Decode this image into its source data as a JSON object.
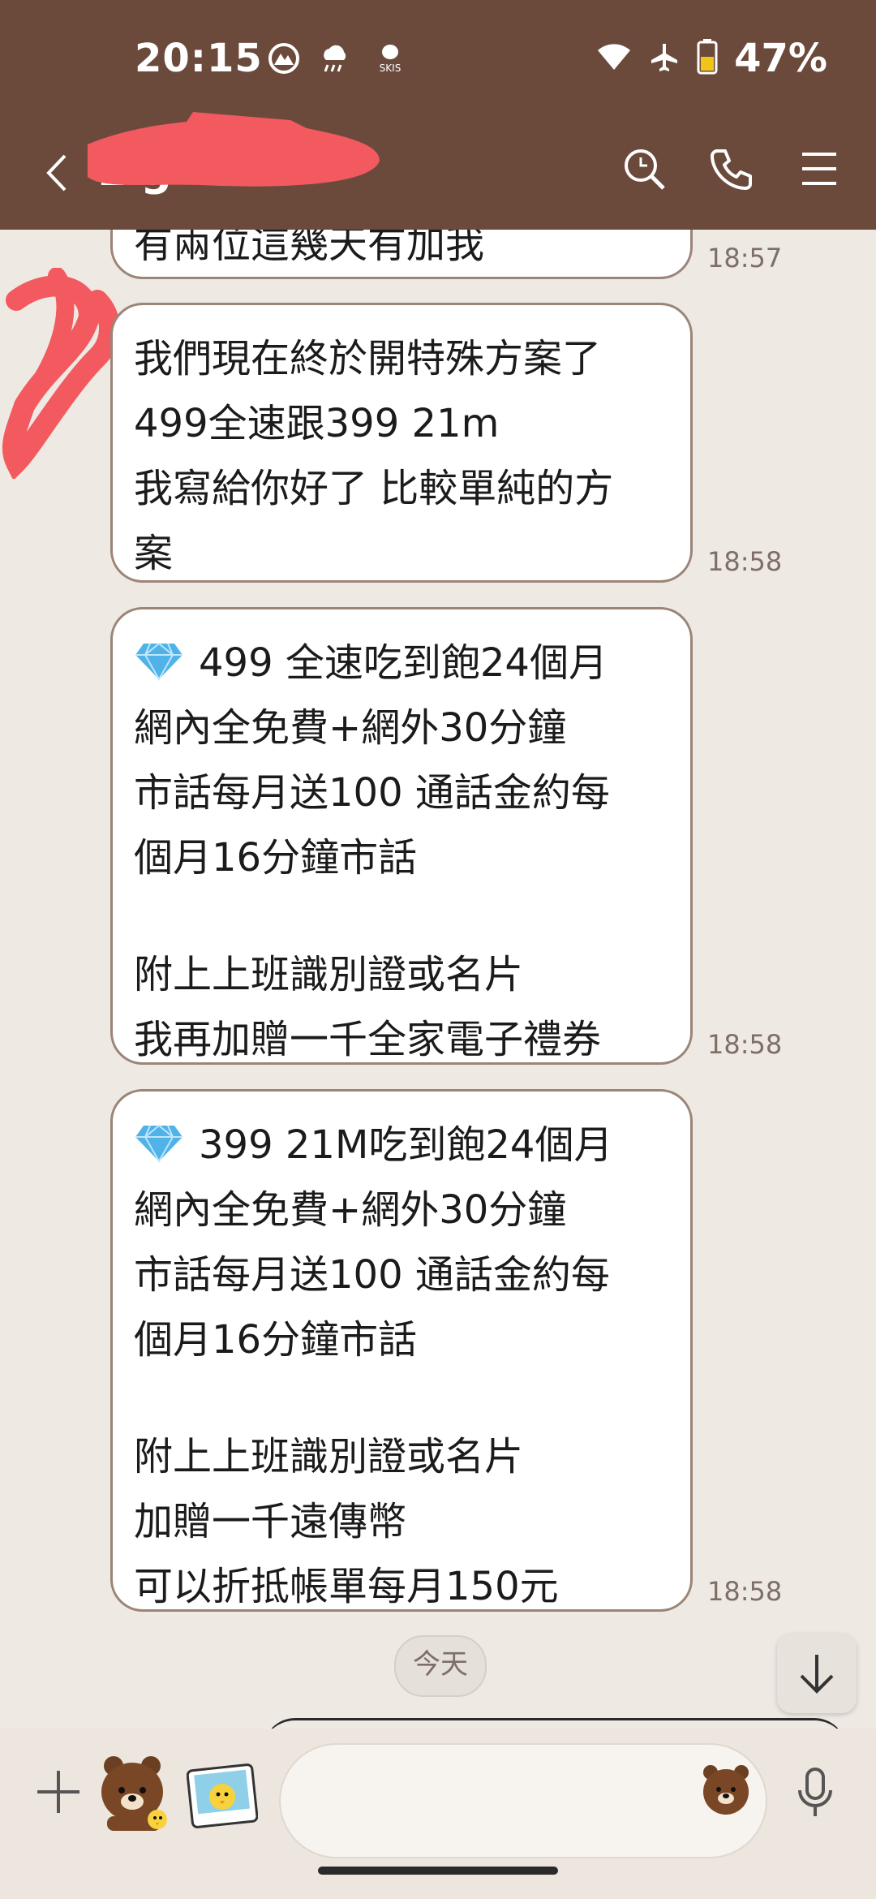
{
  "status_bar": {
    "time": "20:15",
    "battery_percent": "47%",
    "notification_icons": [
      "mountain-icon",
      "weather-rain-icon",
      "skis-app-icon"
    ],
    "skis_label": "SKIS",
    "system_icons": [
      "wifi-icon",
      "airplane-mode-icon",
      "battery-icon"
    ]
  },
  "header": {
    "contact_name": "L          g",
    "icons": [
      "search-icon",
      "phone-icon",
      "menu-icon"
    ],
    "background_color": "#6b4a3c"
  },
  "messages": [
    {
      "lines": [
        "有兩位這幾天有加我"
      ],
      "time": "18:57"
    },
    {
      "lines": [
        "我們現在終於開特殊方案了",
        "499全速跟399 21m",
        "我寫給你好了 比較單純的方",
        "案"
      ],
      "time": "18:58"
    },
    {
      "lines": [
        "499 全速吃到飽24個月",
        "網內全免費+網外30分鐘",
        "市話每月送100 通話金約每",
        "個月16分鐘市話",
        "",
        "附上上班識別證或名片",
        "我再加贈一千全家電子禮券"
      ],
      "time": "18:58"
    },
    {
      "lines": [
        "399 21M吃到飽24個月",
        "網內全免費+網外30分鐘",
        "市話每月送100 通話金約每",
        "個月16分鐘市話",
        "",
        "附上上班識別證或名片",
        "加贈一千遠傳幣",
        "可以折抵帳單每月150元"
      ],
      "time": "18:58"
    }
  ],
  "date_separator": "今天",
  "input_bar": {
    "placeholder": "",
    "icons": [
      "plus-icon",
      "brown-bear-sticker-icon",
      "photo-icon",
      "emoji-bear-icon",
      "microphone-icon"
    ]
  }
}
